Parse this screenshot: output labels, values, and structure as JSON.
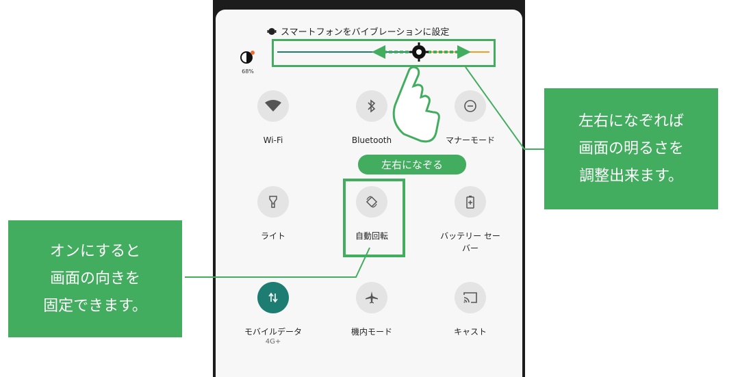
{
  "quick_settings": {
    "vibrate_label": "スマートフォンをバイブレーションに設定",
    "brightness_percent": "68%",
    "brightness_level": 0.68,
    "tiles": [
      {
        "label": "Wi-Fi",
        "icon": "wifi-icon",
        "on": false
      },
      {
        "label": "Bluetooth",
        "icon": "bluetooth-icon",
        "on": false
      },
      {
        "label": "マナーモード",
        "icon": "do-not-disturb-icon",
        "on": false
      },
      {
        "label": "ライト",
        "icon": "flashlight-icon",
        "on": false
      },
      {
        "label": "自動回転",
        "icon": "auto-rotate-icon",
        "on": false
      },
      {
        "label": "バッテリー セーバー",
        "icon": "battery-saver-icon",
        "on": false
      },
      {
        "label": "モバイルデータ",
        "sub": "4G+",
        "icon": "mobile-data-icon",
        "on": true
      },
      {
        "label": "機内モード",
        "icon": "airplane-icon",
        "on": false
      },
      {
        "label": "キャスト",
        "icon": "cast-icon",
        "on": false
      }
    ]
  },
  "annotations": {
    "swipe_hint": "左右になぞる",
    "brightness_callout": "左右になぞれば\n画面の明るさを\n調整出来ます。",
    "rotation_callout": "オンにすると\n画面の向きを\n固定できます。"
  },
  "colors": {
    "accent_green": "#43ad5f",
    "active_tile": "#1e7d73",
    "slider_thumb_track": "#f0a020"
  }
}
